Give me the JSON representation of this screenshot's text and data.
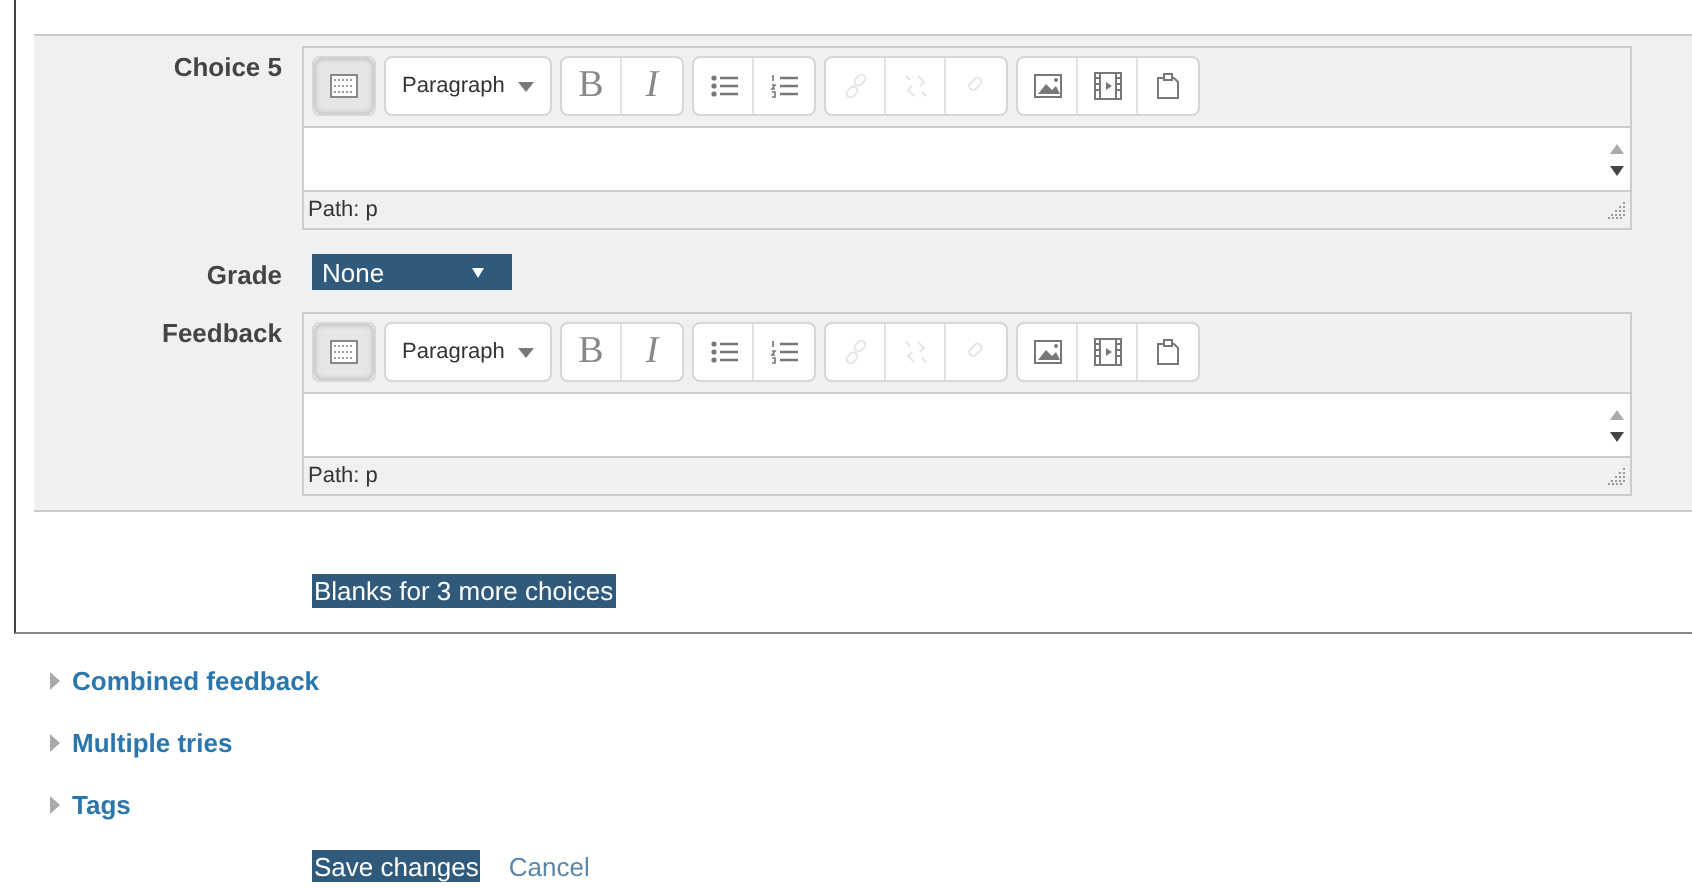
{
  "editors": [
    {
      "label": "Choice 5",
      "toolbar": [
        {
          "kind": "toggle",
          "on": true
        },
        {
          "kind": "dropdown",
          "text": "Paragraph"
        },
        {
          "kind": "bold",
          "text": "B"
        },
        {
          "kind": "italic",
          "text": "I"
        },
        {
          "kind": "bullets"
        },
        {
          "kind": "numbers"
        },
        {
          "kind": "link",
          "disabled": true
        },
        {
          "kind": "unlink",
          "disabled": true
        },
        {
          "kind": "anchor",
          "disabled": true
        },
        {
          "kind": "image"
        },
        {
          "kind": "media"
        },
        {
          "kind": "paste"
        }
      ],
      "path": "Path: p"
    },
    {
      "label": "Feedback",
      "toolbar": [
        {
          "kind": "toggle",
          "on": true
        },
        {
          "kind": "dropdown",
          "text": "Paragraph"
        },
        {
          "kind": "bold",
          "text": "B"
        },
        {
          "kind": "italic",
          "text": "I"
        },
        {
          "kind": "bullets"
        },
        {
          "kind": "numbers"
        },
        {
          "kind": "link",
          "disabled": true
        },
        {
          "kind": "unlink",
          "disabled": true
        },
        {
          "kind": "anchor",
          "disabled": true
        },
        {
          "kind": "image"
        },
        {
          "kind": "media"
        },
        {
          "kind": "paste"
        }
      ],
      "path": "Path: p"
    }
  ],
  "grade": {
    "label": "Grade",
    "value": "None"
  },
  "more_button": "Blanks for 3 more choices",
  "sections": [
    {
      "label": "Combined feedback",
      "expanded": false
    },
    {
      "label": "Multiple tries",
      "expanded": false
    },
    {
      "label": "Tags",
      "expanded": false
    }
  ],
  "save_button": "Save changes",
  "cancel_link": "Cancel"
}
